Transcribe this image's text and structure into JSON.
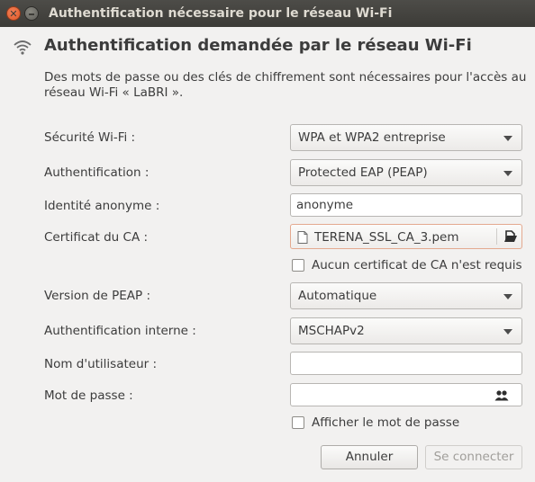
{
  "window": {
    "title": "Authentification nécessaire pour le réseau Wi-Fi"
  },
  "header": {
    "title": "Authentification demandée par le réseau Wi-Fi",
    "description": "Des mots de passe ou des clés de chiffrement sont nécessaires pour l'accès au réseau Wi-Fi « LaBRI »."
  },
  "form": {
    "security": {
      "label": "Sécurité Wi-Fi :",
      "value": "WPA et WPA2 entreprise"
    },
    "auth": {
      "label": "Authentification :",
      "value": "Protected EAP (PEAP)"
    },
    "anon_identity": {
      "label": "Identité anonyme :",
      "value": "anonyme"
    },
    "ca_cert": {
      "label": "Certificat du CA :",
      "value": "TERENA_SSL_CA_3.pem"
    },
    "no_ca_cert": {
      "label": "Aucun certificat de CA n'est requis",
      "checked": false
    },
    "peap_version": {
      "label": "Version de PEAP :",
      "value": "Automatique"
    },
    "inner_auth": {
      "label": "Authentification interne :",
      "value": "MSCHAPv2"
    },
    "username": {
      "label": "Nom d'utilisateur :",
      "value": ""
    },
    "password": {
      "label": "Mot de passe :",
      "value": ""
    },
    "show_password": {
      "label": "Afficher le mot de passe",
      "checked": false
    }
  },
  "buttons": {
    "cancel": "Annuler",
    "connect": "Se connecter"
  },
  "icons": {
    "close": "close-icon",
    "minimize": "minimize-icon",
    "wifi": "wifi-icon",
    "file": "document-icon",
    "open": "folder-open-icon",
    "users": "users-icon"
  },
  "colors": {
    "titlebar": "#3c3b37",
    "close_button": "#e05a2a",
    "background": "#f2f1f0",
    "file_border": "#e4a98f"
  }
}
